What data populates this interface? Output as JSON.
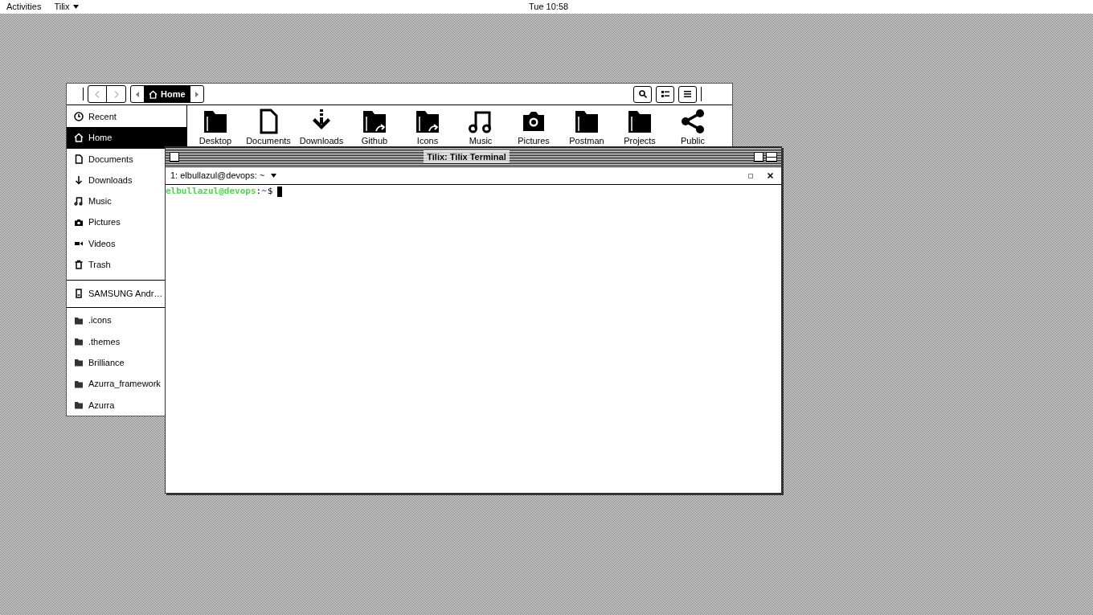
{
  "top_bar": {
    "activities": "Activities",
    "app_menu": "Tilix",
    "clock": "Tue 10:58"
  },
  "file_manager": {
    "path_bar": {
      "current": "Home"
    },
    "sidebar": {
      "places": [
        {
          "label": "Recent",
          "selected": false
        },
        {
          "label": "Home",
          "selected": true
        },
        {
          "label": "Documents",
          "selected": false
        },
        {
          "label": "Downloads",
          "selected": false
        },
        {
          "label": "Music",
          "selected": false
        },
        {
          "label": "Pictures",
          "selected": false
        },
        {
          "label": "Videos",
          "selected": false
        },
        {
          "label": "Trash",
          "selected": false
        }
      ],
      "devices": [
        {
          "label": "SAMSUNG Andr…",
          "selected": false
        }
      ],
      "bookmarks": [
        {
          "label": ".icons",
          "selected": false
        },
        {
          "label": ".themes",
          "selected": false
        },
        {
          "label": "Brilliance",
          "selected": false
        },
        {
          "label": "Azurra_framework",
          "selected": false
        },
        {
          "label": "Azurra",
          "selected": false
        }
      ]
    },
    "folders": [
      "Desktop",
      "Documents",
      "Downloads",
      "Github",
      "Icons",
      "Music",
      "Pictures",
      "Postman",
      "Projects",
      "Public"
    ]
  },
  "terminal": {
    "window_title": "Tilix: Tilix Terminal",
    "session_tab": "1: elbullazul@devops: ~",
    "prompt": {
      "user_host": "elbullazul@devops",
      "separator": ":",
      "path": "~",
      "symbol": "$"
    }
  }
}
